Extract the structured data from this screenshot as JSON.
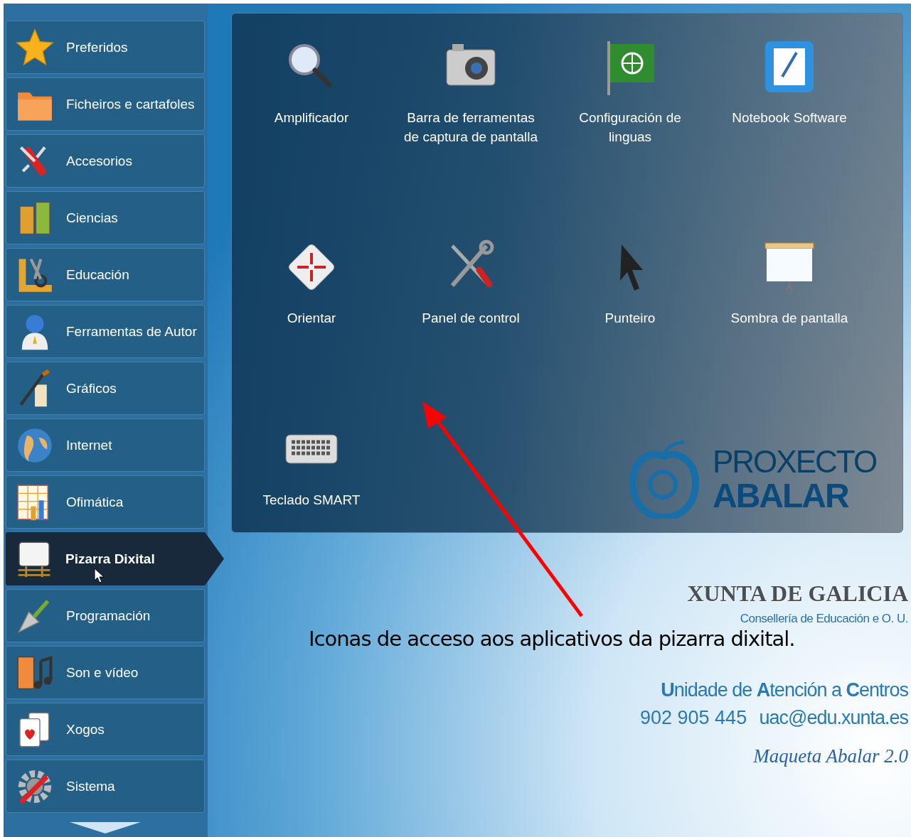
{
  "sidebar": {
    "items": [
      {
        "label": "Preferidos",
        "selected": false
      },
      {
        "label": "Ficheiros e cartafoles",
        "selected": false
      },
      {
        "label": "Accesorios",
        "selected": false
      },
      {
        "label": "Ciencias",
        "selected": false
      },
      {
        "label": "Educación",
        "selected": false
      },
      {
        "label": "Ferramentas de Autor",
        "selected": false
      },
      {
        "label": "Gráficos",
        "selected": false
      },
      {
        "label": "Internet",
        "selected": false
      },
      {
        "label": "Ofimática",
        "selected": false
      },
      {
        "label": "Pizarra Dixital",
        "selected": true
      },
      {
        "label": "Programación",
        "selected": false
      },
      {
        "label": "Son e vídeo",
        "selected": false
      },
      {
        "label": "Xogos",
        "selected": false
      },
      {
        "label": "Sistema",
        "selected": false
      }
    ]
  },
  "panel": {
    "apps": [
      {
        "label": "Amplificador"
      },
      {
        "label": "Barra de ferramentas de captura de pantalla"
      },
      {
        "label": "Configuración de linguas"
      },
      {
        "label": "Notebook Software"
      },
      {
        "label": "Orientar"
      },
      {
        "label": "Panel de control"
      },
      {
        "label": "Punteiro"
      },
      {
        "label": "Sombra de pantalla"
      },
      {
        "label": "Teclado SMART"
      }
    ]
  },
  "wallpaper": {
    "logo_top": "PROXECTO",
    "logo_bottom": "ABALAR",
    "org": "XUNTA DE GALICIA",
    "department": "Consellería de Educación e O. U.",
    "unit": "**U**nidade de **A**tención a **C**entros",
    "phone": "902 905 445",
    "email": "uac@edu.xunta.es",
    "version": "Maqueta Abalar 2.0"
  },
  "annotation": {
    "text": "Iconas de acceso aos aplicativos da pizarra dixital."
  }
}
